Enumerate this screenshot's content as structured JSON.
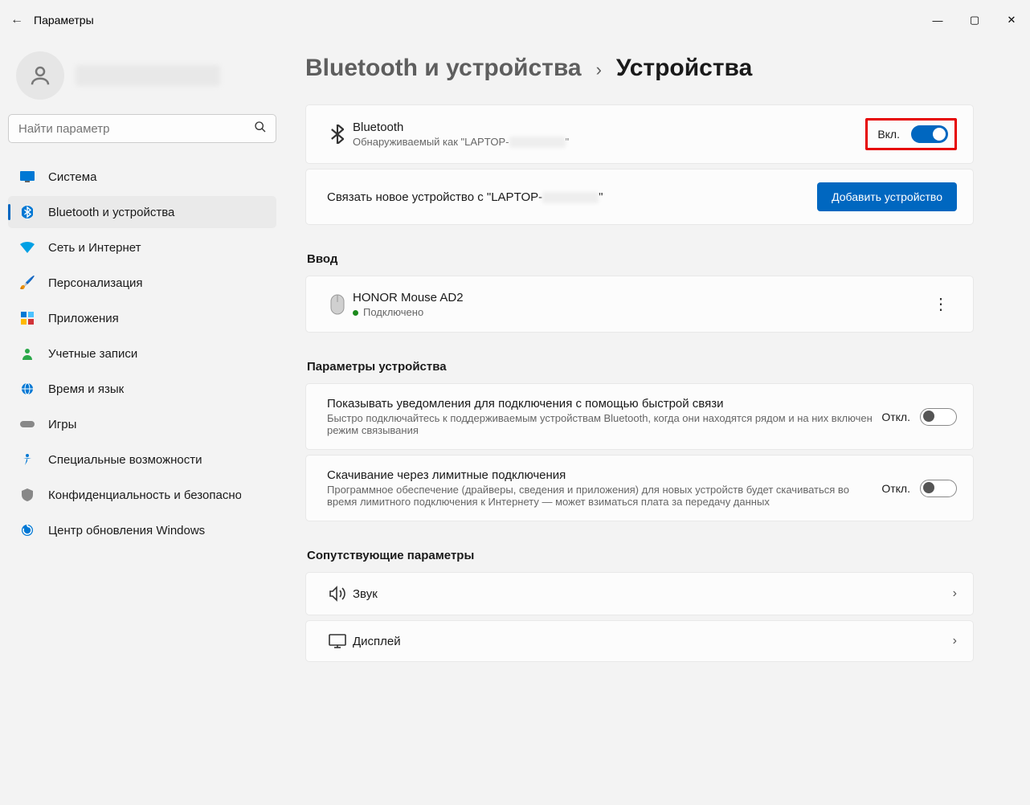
{
  "window": {
    "title": "Параметры"
  },
  "search": {
    "placeholder": "Найти параметр"
  },
  "sidebar": {
    "items": [
      {
        "label": "Система",
        "icon": "🖥️"
      },
      {
        "label": "Bluetooth и устройства",
        "icon": "bt"
      },
      {
        "label": "Сеть и Интернет",
        "icon": "🔷"
      },
      {
        "label": "Персонализация",
        "icon": "🖌️"
      },
      {
        "label": "Приложения",
        "icon": "🗂️"
      },
      {
        "label": "Учетные записи",
        "icon": "👤"
      },
      {
        "label": "Время и язык",
        "icon": "🌐"
      },
      {
        "label": "Игры",
        "icon": "🎮"
      },
      {
        "label": "Специальные возможности",
        "icon": "♿"
      },
      {
        "label": "Конфиденциальность и безопасность",
        "icon": "🛡️"
      },
      {
        "label": "Центр обновления Windows",
        "icon": "🔄"
      }
    ]
  },
  "breadcrumb": {
    "parent": "Bluetooth и устройства",
    "current": "Устройства"
  },
  "bluetooth": {
    "title": "Bluetooth",
    "subtitle_prefix": "Обнаруживаемый как \"LAPTOP-",
    "subtitle_suffix": "\"",
    "state_label": "Вкл."
  },
  "pair": {
    "text_prefix": "Связать новое устройство с \"LAPTOP-",
    "text_suffix": "\"",
    "button": "Добавить устройство"
  },
  "sections": {
    "input": "Ввод",
    "device_params": "Параметры устройства",
    "related": "Сопутствующие параметры"
  },
  "mouse": {
    "name": "HONOR Mouse AD2",
    "status": "Подключено"
  },
  "params": {
    "fast_pair": {
      "title": "Показывать уведомления для подключения с помощью быстрой связи",
      "desc": "Быстро подключайтесь к поддерживаемым устройствам Bluetooth, когда они находятся рядом и на них включен режим связывания",
      "state": "Откл."
    },
    "metered": {
      "title": "Скачивание через лимитные подключения",
      "desc": "Программное обеспечение (драйверы, сведения и приложения) для новых устройств будет скачиваться во время лимитного подключения к Интернету — может взиматься плата за передачу данных",
      "state": "Откл."
    }
  },
  "related": {
    "sound": "Звук",
    "display": "Дисплей"
  }
}
